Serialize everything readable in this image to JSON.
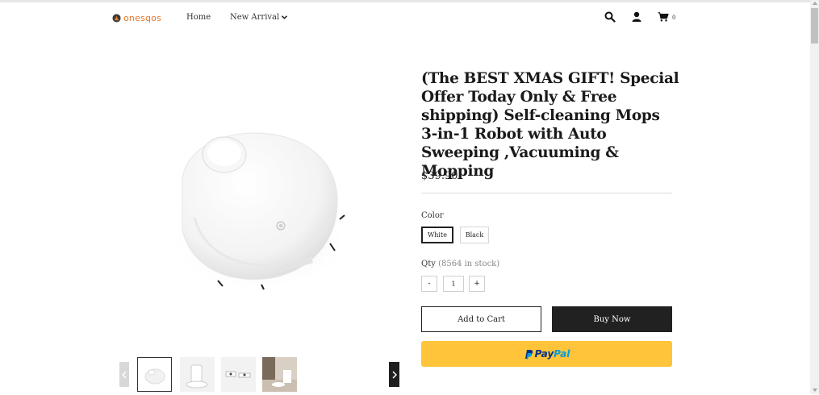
{
  "header": {
    "logo_text": "onesqos",
    "nav": {
      "home": "Home",
      "new_arrival": "New Arrival"
    },
    "cart_count": "0",
    "icons": [
      "search-icon",
      "user-icon",
      "cart-icon"
    ]
  },
  "product": {
    "title": "(The BEST XMAS GIFT! Special Offer Today Only & Free shipping) Self-cleaning Mops 3-in-1 Robot with Auto Sweeping ,Vacuuming & Mopping",
    "price": "$39.90",
    "color_label": "Color",
    "colors": [
      {
        "label": "White",
        "selected": true
      },
      {
        "label": "Black",
        "selected": false
      }
    ],
    "qty_label": "Qty",
    "stock_text": "(8564 in stock)",
    "qty_minus": "-",
    "qty_plus": "+",
    "qty_value": "1",
    "add_to_cart": "Add to Cart",
    "buy_now": "Buy Now",
    "paypal": {
      "pay": "Pay",
      "pal": "Pal"
    }
  },
  "gallery": {
    "main_image": "robot-vacuum-white",
    "thumbnails": [
      "robot-vacuum-top",
      "robot-dock-station",
      "robot-mop-accessories",
      "robot-in-room"
    ],
    "active_index": 0
  },
  "colors": {
    "brand": "#e4772b",
    "buy_now_bg": "#212121",
    "paypal_bg": "#ffc439",
    "paypal_dark": "#003087",
    "paypal_light": "#009cde"
  }
}
